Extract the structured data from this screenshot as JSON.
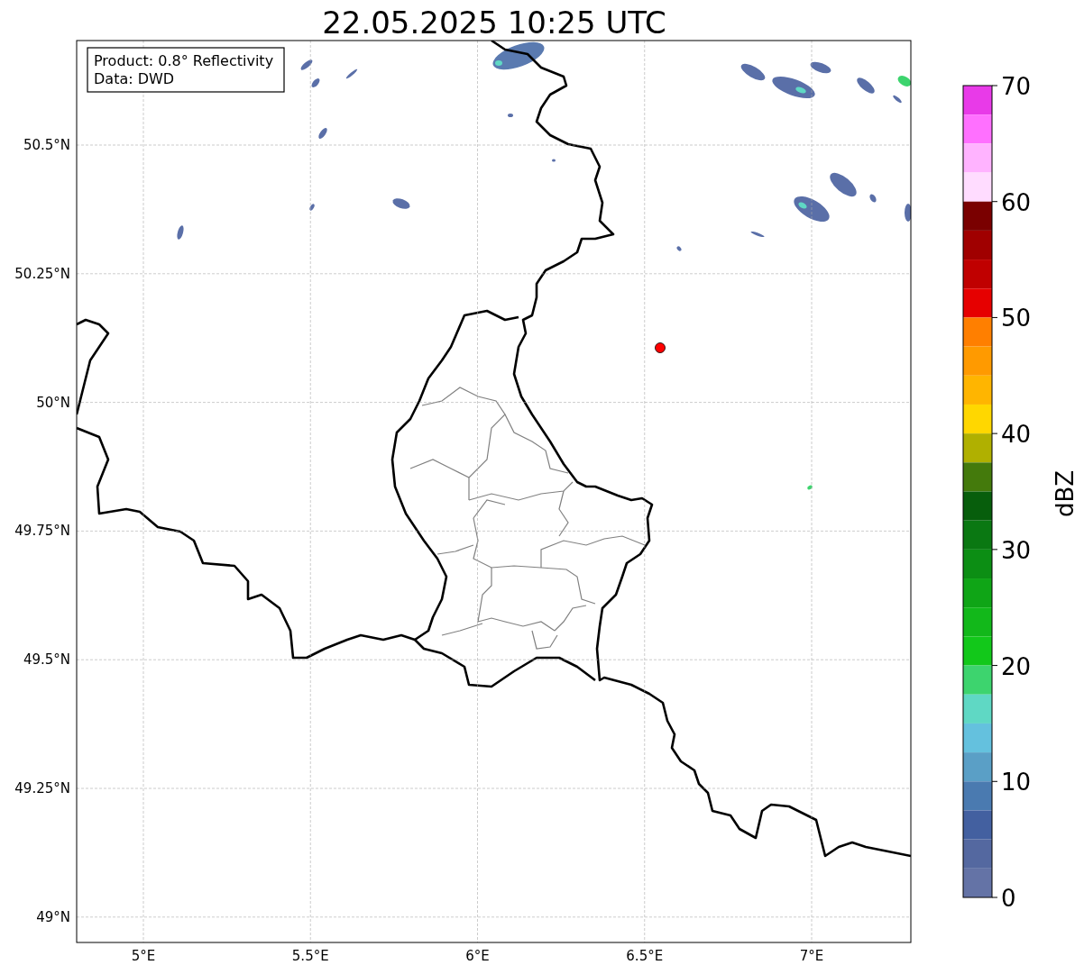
{
  "title": "22.05.2025 10:25 UTC",
  "info_box": {
    "lines": [
      "Product: 0.8° Reflectivity",
      "Data: DWD"
    ]
  },
  "map": {
    "lat_ticks": [
      "50.5°N",
      "50.25°N",
      "50°N",
      "49.75°N",
      "49.5°N",
      "49.25°N",
      "49°N"
    ],
    "lon_ticks": [
      "5°E",
      "5.5°E",
      "6°E",
      "6.5°E",
      "7°E"
    ]
  },
  "colorbar": {
    "label": "dBZ",
    "ticks": [
      "70",
      "60",
      "50",
      "40",
      "30",
      "20",
      "10",
      "0"
    ],
    "segments": [
      {
        "color": "#e83ae8"
      },
      {
        "color": "#ff70ff"
      },
      {
        "color": "#ffb3ff"
      },
      {
        "color": "#ffdcff"
      },
      {
        "color": "#7a0000"
      },
      {
        "color": "#a00000"
      },
      {
        "color": "#c00000"
      },
      {
        "color": "#e60000"
      },
      {
        "color": "#ff7f00"
      },
      {
        "color": "#ff9a00"
      },
      {
        "color": "#ffb500"
      },
      {
        "color": "#ffd700"
      },
      {
        "color": "#b0b000"
      },
      {
        "color": "#447a0c"
      },
      {
        "color": "#075e0c"
      },
      {
        "color": "#0a7812"
      },
      {
        "color": "#0c8e14"
      },
      {
        "color": "#0fa516"
      },
      {
        "color": "#12b81a"
      },
      {
        "color": "#12c81a"
      },
      {
        "color": "#3dd46e"
      },
      {
        "color": "#5fd8c4"
      },
      {
        "color": "#64c1de"
      },
      {
        "color": "#5a9fc6"
      },
      {
        "color": "#4a7ab0"
      },
      {
        "color": "#4360a0"
      },
      {
        "color": "#5468a0"
      },
      {
        "color": "#6473a6"
      }
    ]
  }
}
